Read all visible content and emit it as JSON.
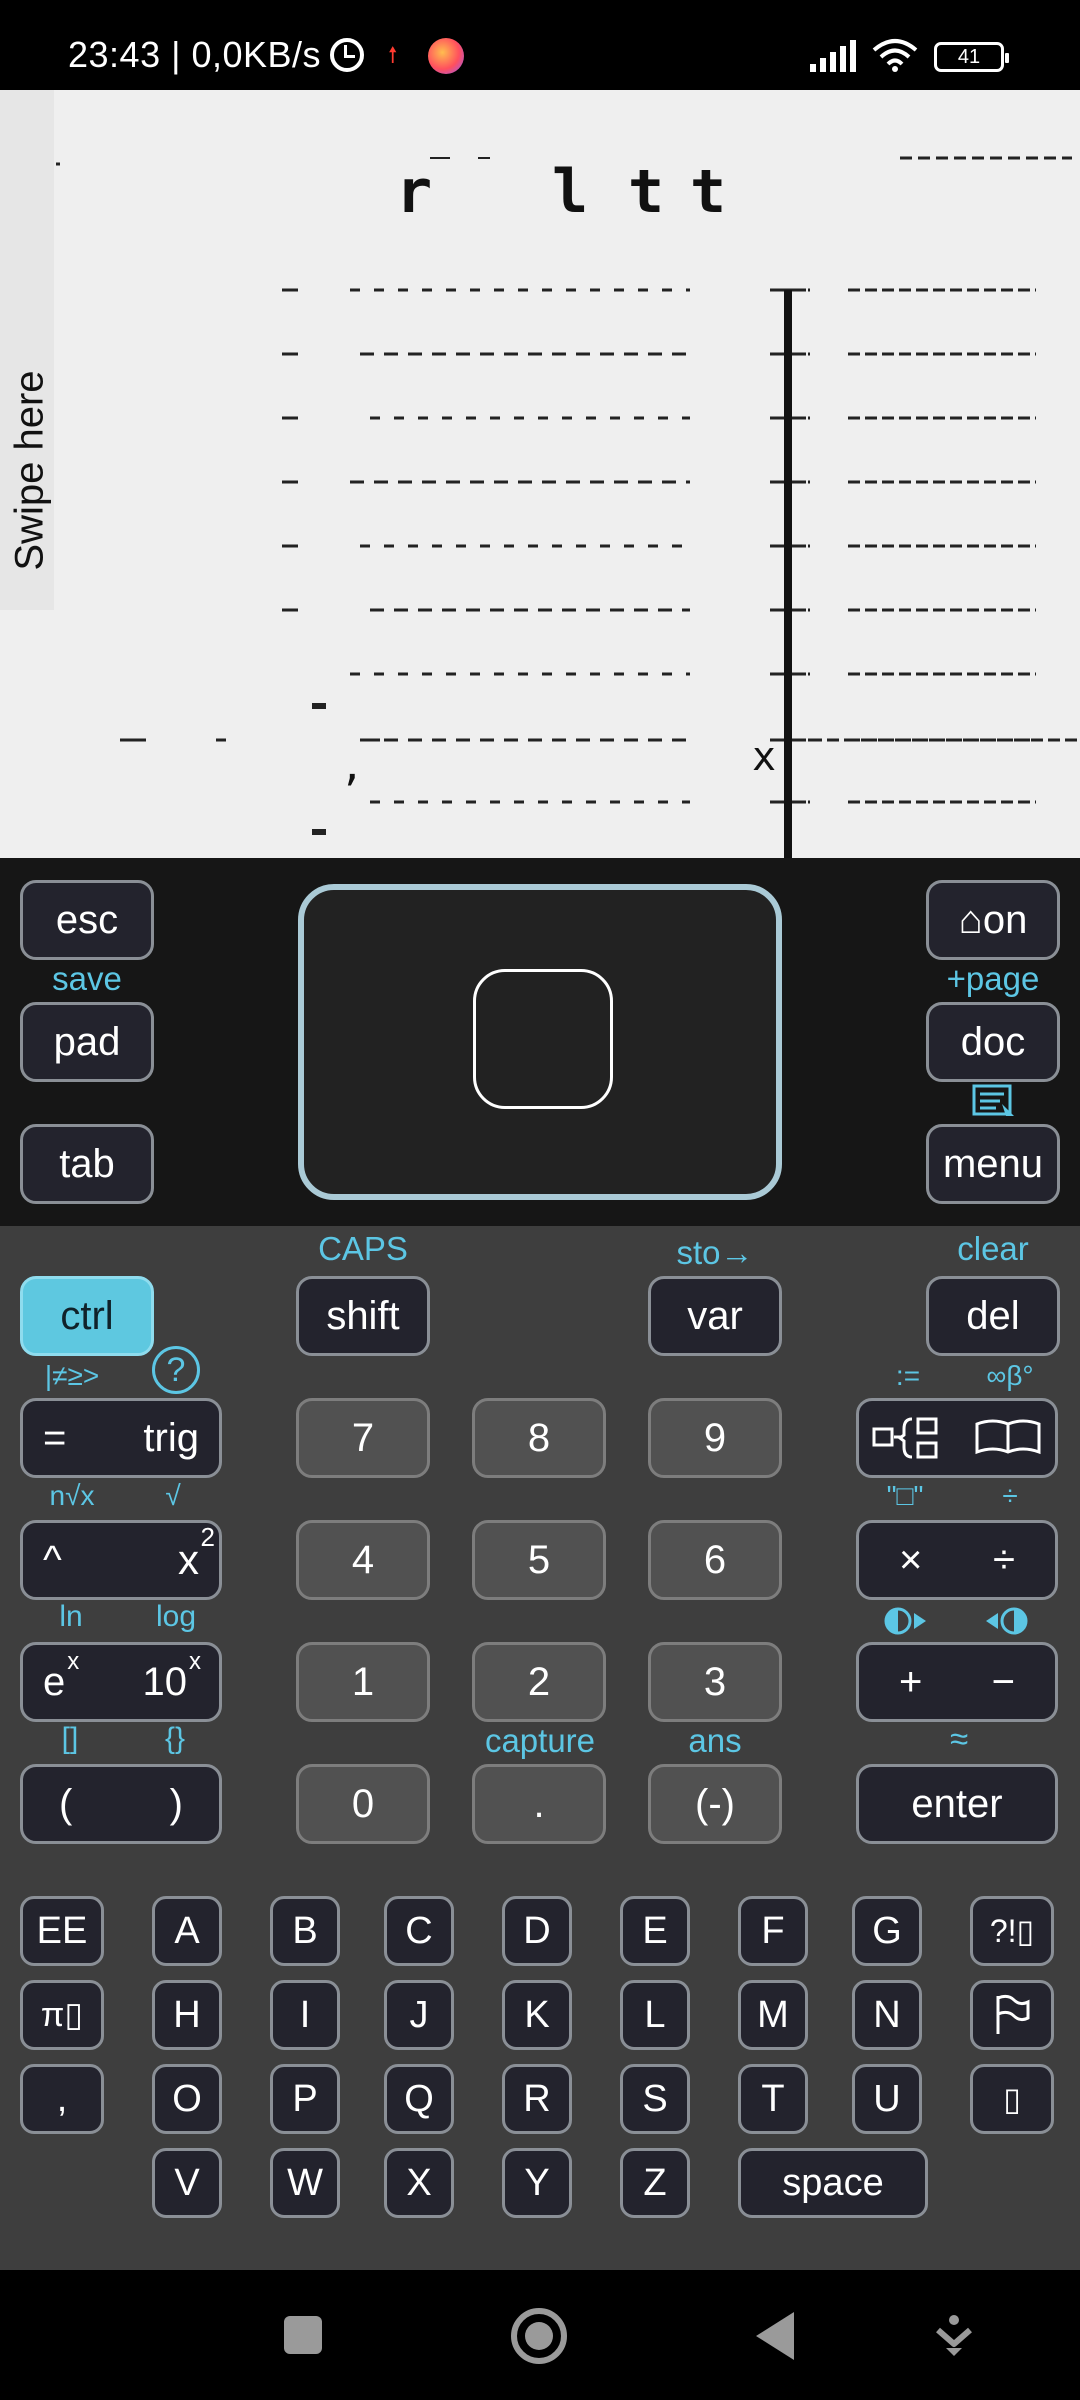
{
  "status_bar": {
    "time": "23:43 | 0,0KB/s",
    "battery": "41",
    "icons": [
      "alarm-icon",
      "upload-icon",
      "firefox-icon",
      "signal-icon",
      "wifi-icon",
      "battery-icon"
    ]
  },
  "screen": {
    "swipe_label": "Swipe here",
    "title_glyphs": [
      "r",
      "l",
      "t",
      "t"
    ],
    "cell_marks": [
      ",",
      "x"
    ]
  },
  "top_panel": {
    "esc": "esc",
    "save": "save",
    "pad": "pad",
    "tab": "tab",
    "on": "⌂on",
    "page": "+page",
    "doc": "doc",
    "menu": "menu"
  },
  "keypad": {
    "ctrl": "ctrl",
    "caps": "CAPS",
    "shift": "shift",
    "sto": "sto→",
    "var": "var",
    "clear": "clear",
    "del": "del",
    "sub_eq": "|≠≥>",
    "help": "?",
    "assign": ":=",
    "inf": "∞β°",
    "eq": "=",
    "trig": "trig",
    "seven": "7",
    "eight": "8",
    "nine": "9",
    "nthroot": "n√x",
    "sqrt": "√",
    "template": "\"□\"",
    "divsub": "÷",
    "caret": "^",
    "xsq": "x",
    "two_sup": "2",
    "four": "4",
    "five": "5",
    "six": "6",
    "times": "×",
    "div": "÷",
    "ln": "ln",
    "log": "log",
    "ex": "e",
    "x_sup": "x",
    "ten": "10",
    "x_sup2": "x",
    "one": "1",
    "two": "2",
    "three": "3",
    "plus": "+",
    "minus": "−",
    "brackets": "[]",
    "braces": "{}",
    "capture": "capture",
    "ans": "ans",
    "approx": "≈",
    "lparen": "(",
    "rparen": ")",
    "zero": "0",
    "dot": ".",
    "neg": "(-)",
    "enter": "enter"
  },
  "alpha_keys": {
    "row1": [
      "EE",
      "A",
      "B",
      "C",
      "D",
      "E",
      "F",
      "G",
      "?!▯"
    ],
    "row2": [
      "π▯",
      "H",
      "I",
      "J",
      "K",
      "L",
      "M",
      "N"
    ],
    "row3": [
      ",",
      "O",
      "P",
      "Q",
      "R",
      "S",
      "T",
      "U",
      "▯"
    ],
    "row4": [
      "V",
      "W",
      "X",
      "Y",
      "Z"
    ],
    "space": "space"
  },
  "colors": {
    "accent": "#5cc6e4",
    "key_dark": "#23232d",
    "key_gray": "#515151",
    "ctrl_active": "#5ec8e0",
    "keypad_bg": "#3e3e3e",
    "screen_bg": "#efefef"
  }
}
